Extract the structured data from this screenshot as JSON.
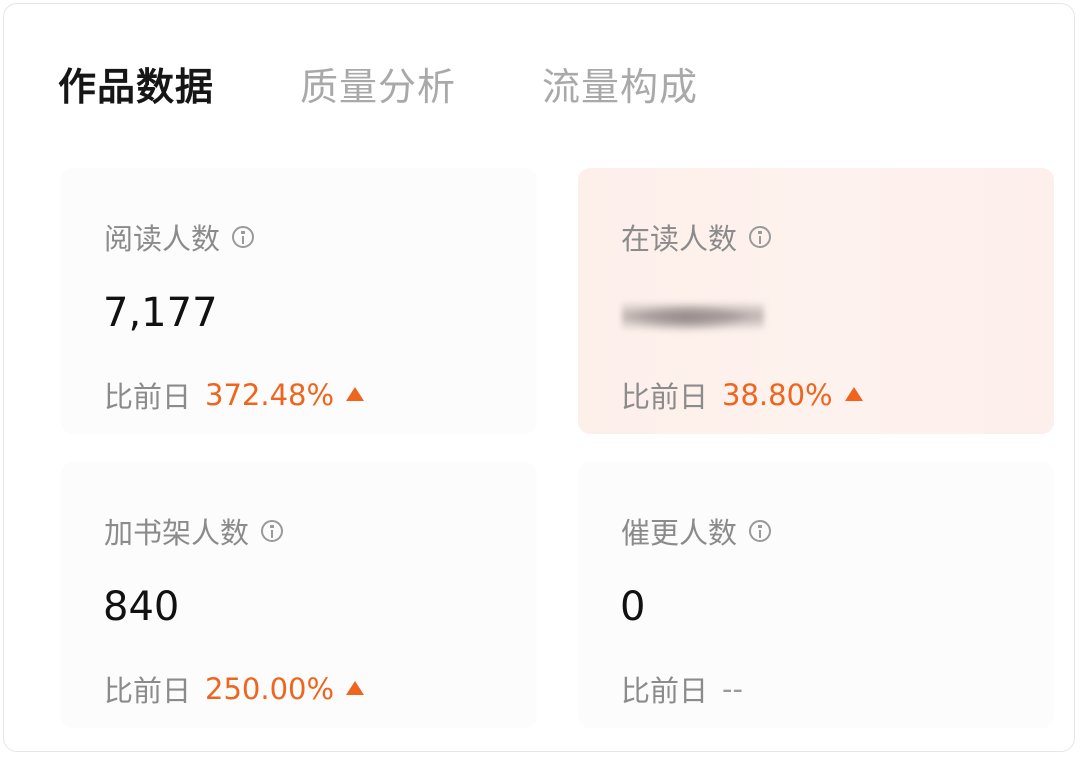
{
  "tabs": [
    {
      "label": "作品数据",
      "active": true
    },
    {
      "label": "质量分析",
      "active": false
    },
    {
      "label": "流量构成",
      "active": false
    }
  ],
  "metrics": [
    {
      "label": "阅读人数",
      "value": "7,177",
      "compare_label": "比前日",
      "change": "372.48%",
      "trend": "up"
    },
    {
      "label": "在读人数",
      "value_blurred": true,
      "compare_label": "比前日",
      "change": "38.80%",
      "trend": "up"
    },
    {
      "label": "加书架人数",
      "value": "840",
      "compare_label": "比前日",
      "change": "250.00%",
      "trend": "up"
    },
    {
      "label": "催更人数",
      "value": "0",
      "compare_label": "比前日",
      "change": "--",
      "trend": "none"
    }
  ],
  "colors": {
    "accent": "#f0651e",
    "active_tab": "#161616",
    "inactive_tab": "#a9a9a9",
    "label": "#8b8b8b",
    "highlight_card": "#fdf0eb"
  },
  "icons": [
    "info-icon",
    "arrow-up-icon"
  ]
}
